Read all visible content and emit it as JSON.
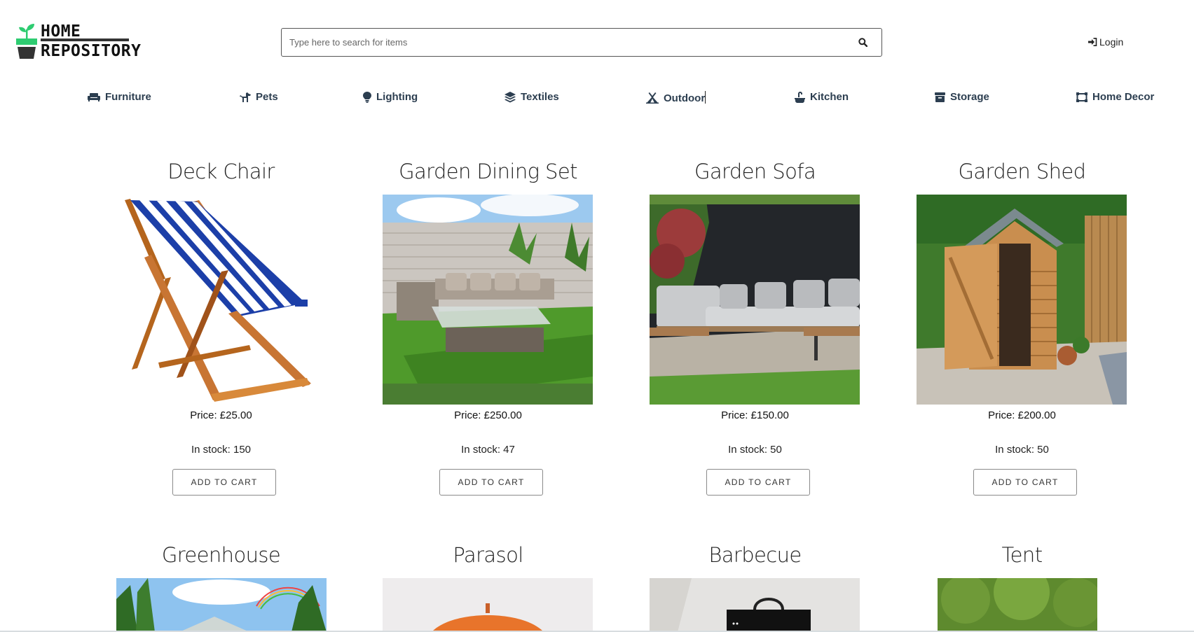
{
  "brand": {
    "line1": "HOME",
    "line2": "REPOSITORY",
    "accent": "#2ecc71"
  },
  "search": {
    "placeholder": "Type here to search for items",
    "icon": "search-icon"
  },
  "login": {
    "label": "Login",
    "icon": "sign-in-icon"
  },
  "categories": [
    {
      "label": "Furniture",
      "icon": "couch-icon"
    },
    {
      "label": "Pets",
      "icon": "dog-icon"
    },
    {
      "label": "Lighting",
      "icon": "lightbulb-icon"
    },
    {
      "label": "Textiles",
      "icon": "layers-icon"
    },
    {
      "label": "Outdoor",
      "icon": "campground-icon"
    },
    {
      "label": "Kitchen",
      "icon": "sink-icon"
    },
    {
      "label": "Storage",
      "icon": "archive-icon"
    },
    {
      "label": "Home Decor",
      "icon": "picture-frame-icon"
    }
  ],
  "products": [
    {
      "name": "Deck Chair",
      "price": "Price: £25.00",
      "stock": "In stock: 150",
      "button": "ADD TO CART"
    },
    {
      "name": "Garden Dining Set",
      "price": "Price: £250.00",
      "stock": "In stock: 47",
      "button": "ADD TO CART"
    },
    {
      "name": "Garden Sofa",
      "price": "Price: £150.00",
      "stock": "In stock: 50",
      "button": "ADD TO CART"
    },
    {
      "name": "Garden Shed",
      "price": "Price: £200.00",
      "stock": "In stock: 50",
      "button": "ADD TO CART"
    },
    {
      "name": "Greenhouse"
    },
    {
      "name": "Parasol"
    },
    {
      "name": "Barbecue"
    },
    {
      "name": "Tent"
    }
  ]
}
